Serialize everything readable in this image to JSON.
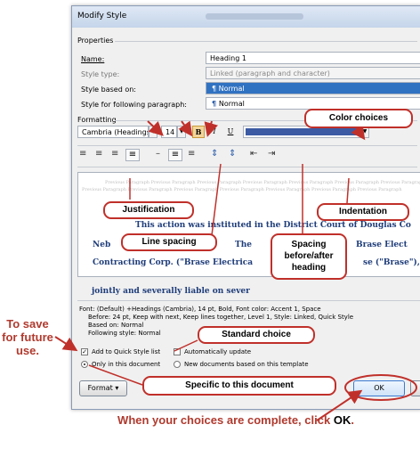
{
  "dialog": {
    "title": "Modify Style",
    "properties_label": "Properties",
    "name_label": "Name:",
    "name_value": "Heading 1",
    "style_type_label": "Style type:",
    "style_type_value": "Linked (paragraph and character)",
    "based_on_label": "Style based on:",
    "based_on_value": "Normal",
    "following_label": "Style for following paragraph:",
    "following_value": "Normal",
    "formatting_label": "Formatting",
    "font_value": "Cambria (Headings)",
    "size_value": "14",
    "bold_label": "B",
    "italic_label": "I",
    "underline_label": "U",
    "font_color": "#3b5aa3",
    "preview_lines": [
      "This action was instituted in the District Court of Douglas Co",
      "Neb",
      "The",
      "Brase Elect",
      "Contracting Corp. (\"Brase Electrica",
      "se (\"Brase\"),",
      "jointly and severally liable on sever"
    ],
    "preview_prev_text": "Previous Paragraph Previous Paragraph Previous Paragraph Previous Paragraph Previous Paragraph Previous Paragraph Previous Paragraph",
    "description_lines": [
      "Font: (Default) +Headings (Cambria), 14 pt, Bold, Font color: Accent 1, Space",
      "Before:  24 pt, Keep with next, Keep lines together, Level 1, Style: Linked, Quick Style",
      "Based on: Normal",
      "Following style: Normal"
    ],
    "add_quick_style_label": "Add to Quick Style list",
    "auto_update_label": "Automatically update",
    "only_document_label": "Only in this document",
    "new_documents_label": "New documents based on this template",
    "format_button": "Format",
    "ok_button": "OK"
  },
  "annotations": {
    "color_choices": "Color choices",
    "justification": "Justification",
    "indentation": "Indentation",
    "line_spacing": "Line spacing",
    "spacing": "Spacing before/after heading",
    "standard_choice": "Standard choice",
    "specific": "Specific to this document",
    "save_future": "To save for future use.",
    "when_complete": "When your choices are complete, click",
    "when_complete_ok": "OK"
  },
  "colors": {
    "annotation_red": "#c0302a",
    "annotation_text_red": "#b03a2e",
    "preview_blue": "#1f3d7a",
    "selection_blue": "#3072c2"
  }
}
